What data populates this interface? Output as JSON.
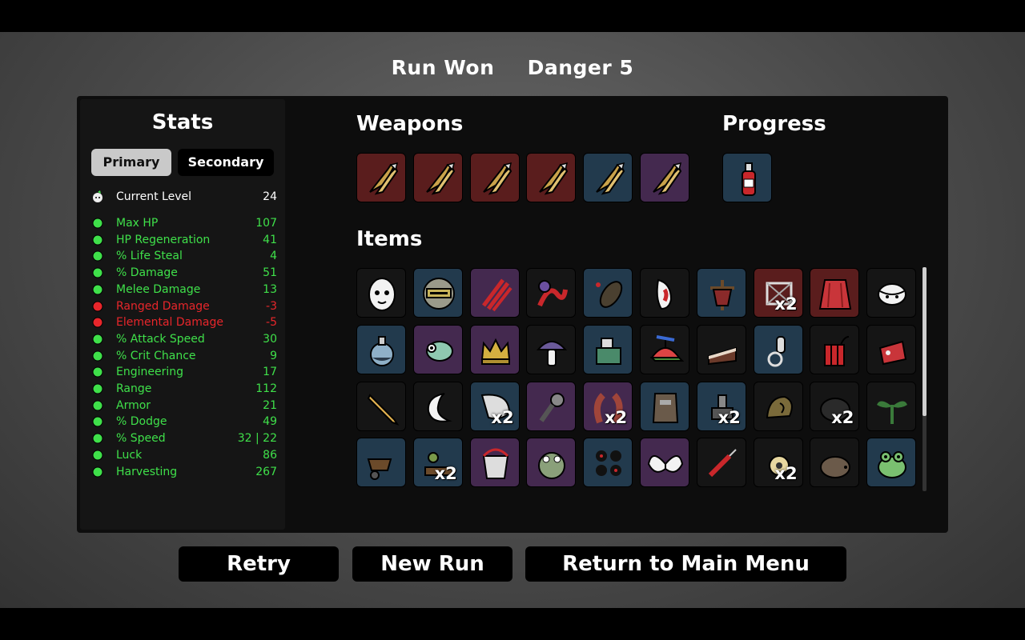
{
  "header": {
    "status": "Run Won",
    "danger": "Danger 5"
  },
  "stats": {
    "title": "Stats",
    "tabs": {
      "primary": "Primary",
      "secondary": "Secondary"
    },
    "level": {
      "label": "Current Level",
      "value": "24"
    },
    "rows": [
      {
        "label": "Max HP",
        "value": "107",
        "color": "#3fe04a",
        "icon": "heart-icon"
      },
      {
        "label": "HP Regeneration",
        "value": "41",
        "color": "#3fe04a",
        "icon": "regen-icon"
      },
      {
        "label": "% Life Steal",
        "value": "4",
        "color": "#3fe04a",
        "icon": "lifesteal-icon"
      },
      {
        "label": "% Damage",
        "value": "51",
        "color": "#3fe04a",
        "icon": "muscle-icon"
      },
      {
        "label": "Melee Damage",
        "value": "13",
        "color": "#3fe04a",
        "icon": "sword-icon"
      },
      {
        "label": "Ranged Damage",
        "value": "-3",
        "color": "#e8262b",
        "icon": "bow-icon"
      },
      {
        "label": "Elemental Damage",
        "value": "-5",
        "color": "#e8262b",
        "icon": "flame-icon"
      },
      {
        "label": "% Attack Speed",
        "value": "30",
        "color": "#3fe04a",
        "icon": "hourglass-icon"
      },
      {
        "label": "% Crit Chance",
        "value": "9",
        "color": "#3fe04a",
        "icon": "crit-icon"
      },
      {
        "label": "Engineering",
        "value": "17",
        "color": "#3fe04a",
        "icon": "wrench-icon"
      },
      {
        "label": "Range",
        "value": "112",
        "color": "#3fe04a",
        "icon": "range-icon"
      },
      {
        "label": "Armor",
        "value": "21",
        "color": "#3fe04a",
        "icon": "shield-icon"
      },
      {
        "label": "% Dodge",
        "value": "49",
        "color": "#3fe04a",
        "icon": "dodge-icon"
      },
      {
        "label": "% Speed",
        "value": "32 | 22",
        "color": "#3fe04a",
        "icon": "boot-icon"
      },
      {
        "label": "Luck",
        "value": "86",
        "color": "#3fe04a",
        "icon": "dice-icon"
      },
      {
        "label": "Harvesting",
        "value": "267",
        "color": "#3fe04a",
        "icon": "wheat-icon"
      }
    ]
  },
  "weapons": {
    "title": "Weapons",
    "slots": [
      {
        "tier": "red",
        "icon": "pruner-icon"
      },
      {
        "tier": "red",
        "icon": "pruner-icon"
      },
      {
        "tier": "red",
        "icon": "pruner-icon"
      },
      {
        "tier": "red",
        "icon": "pruner-icon"
      },
      {
        "tier": "blue",
        "icon": "pruner-icon"
      },
      {
        "tier": "purple",
        "icon": "pruner-icon"
      }
    ]
  },
  "progress": {
    "title": "Progress",
    "slots": [
      {
        "tier": "blue",
        "icon": "ketchup-bottle-icon"
      }
    ]
  },
  "items": {
    "title": "Items",
    "slots": [
      {
        "tier": "black",
        "icon": "ghost-egg-icon",
        "qty": ""
      },
      {
        "tier": "blue",
        "icon": "helmet-icon",
        "qty": ""
      },
      {
        "tier": "purple",
        "icon": "claw-slash-icon",
        "qty": ""
      },
      {
        "tier": "black",
        "icon": "snake-icon",
        "qty": ""
      },
      {
        "tier": "blue",
        "icon": "larva-icon",
        "qty": ""
      },
      {
        "tier": "black",
        "icon": "fang-icon",
        "qty": ""
      },
      {
        "tier": "blue",
        "icon": "scarecrow-icon",
        "qty": ""
      },
      {
        "tier": "red",
        "icon": "trap-icon",
        "qty": "x2"
      },
      {
        "tier": "red",
        "icon": "cape-icon",
        "qty": ""
      },
      {
        "tier": "black",
        "icon": "bandage-icon",
        "qty": ""
      },
      {
        "tier": "blue",
        "icon": "potion-icon",
        "qty": ""
      },
      {
        "tier": "purple",
        "icon": "chameleon-icon",
        "qty": ""
      },
      {
        "tier": "purple",
        "icon": "crown-icon",
        "qty": ""
      },
      {
        "tier": "black",
        "icon": "mushroom-icon",
        "qty": ""
      },
      {
        "tier": "blue",
        "icon": "machine-icon",
        "qty": ""
      },
      {
        "tier": "black",
        "icon": "propeller-hat-icon",
        "qty": ""
      },
      {
        "tier": "black",
        "icon": "cake-icon",
        "qty": ""
      },
      {
        "tier": "blue",
        "icon": "robot-arm-icon",
        "qty": ""
      },
      {
        "tier": "black",
        "icon": "dynamite-icon",
        "qty": ""
      },
      {
        "tier": "black",
        "icon": "meat-icon",
        "qty": ""
      },
      {
        "tier": "black",
        "icon": "pencil-icon",
        "qty": ""
      },
      {
        "tier": "black",
        "icon": "moon-icon",
        "qty": ""
      },
      {
        "tier": "blue",
        "icon": "horn-icon",
        "qty": "x2"
      },
      {
        "tier": "purple",
        "icon": "scope-icon",
        "qty": ""
      },
      {
        "tier": "purple",
        "icon": "tentacle-icon",
        "qty": "x2"
      },
      {
        "tier": "blue",
        "icon": "armor-plate-icon",
        "qty": ""
      },
      {
        "tier": "blue",
        "icon": "turret-icon",
        "qty": "x2"
      },
      {
        "tier": "black",
        "icon": "snail-icon",
        "qty": ""
      },
      {
        "tier": "black",
        "icon": "rock-icon",
        "qty": "x2"
      },
      {
        "tier": "black",
        "icon": "sprout-icon",
        "qty": ""
      },
      {
        "tier": "blue",
        "icon": "wheelbarrow-icon",
        "qty": ""
      },
      {
        "tier": "blue",
        "icon": "garden-icon",
        "qty": "x2"
      },
      {
        "tier": "purple",
        "icon": "bucket-icon",
        "qty": ""
      },
      {
        "tier": "purple",
        "icon": "frog-alien-icon",
        "qty": ""
      },
      {
        "tier": "blue",
        "icon": "eyes-icon",
        "qty": ""
      },
      {
        "tier": "purple",
        "icon": "wings-icon",
        "qty": ""
      },
      {
        "tier": "black",
        "icon": "syringe-icon",
        "qty": ""
      },
      {
        "tier": "black",
        "icon": "bug-icon",
        "qty": "x2"
      },
      {
        "tier": "black",
        "icon": "hedgehog-icon",
        "qty": ""
      },
      {
        "tier": "blue",
        "icon": "frog-icon",
        "qty": ""
      }
    ]
  },
  "buttons": {
    "retry": "Retry",
    "new_run": "New Run",
    "main_menu": "Return to Main Menu"
  }
}
